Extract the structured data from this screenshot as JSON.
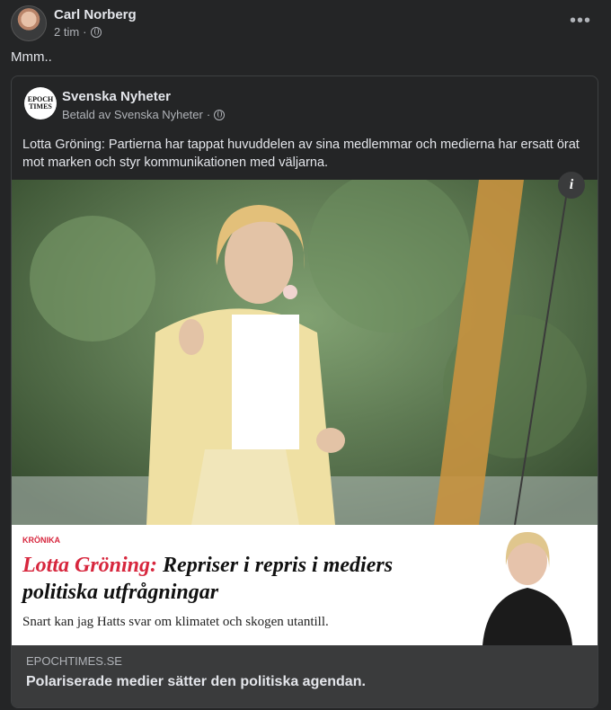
{
  "post": {
    "author": "Carl Norberg",
    "time": "2 tim",
    "text": "Mmm..",
    "more_icon": "more-horiz-icon"
  },
  "shared": {
    "page_name": "Svenska Nyheter",
    "sponsored_by": "Betald av Svenska Nyheter",
    "logo_text": "EPOCH TIMES",
    "ad_text": "Lotta Gröning: Partierna har tappat huvuddelen av sina medlemmar och medierna har ersatt örat mot marken och styr kommunikationen med väljarna.",
    "banner": {
      "kicker": "KRÖNIKA",
      "headline_red": "Lotta Gröning:",
      "headline_rest": "Repriser i repris i mediers politiska utfrågningar",
      "standfirst": "Snart kan jag Hatts svar om klimatet och skogen utantill."
    },
    "link": {
      "domain": "EPOCHTIMES.SE",
      "title": "Polariserade medier sätter den politiska agendan."
    }
  },
  "colors": {
    "background": "#242526",
    "card": "#3a3b3c",
    "accent_red": "#d7263d"
  }
}
